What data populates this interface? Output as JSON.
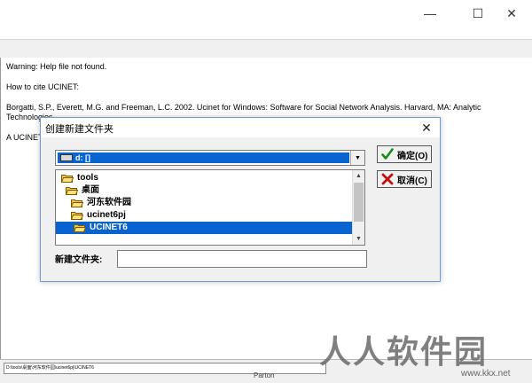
{
  "window": {
    "controls": {
      "minimize": "—",
      "maximize": "☐",
      "close": "✕"
    }
  },
  "main": {
    "lines": [
      "Warning: Help file not found.",
      "How to cite UCINET:",
      "Borgatti, S.P., Everett, M.G. and Freeman, L.C. 2002. Ucinet for Windows: Software for Social Network Analysis. Harvard, MA: Analytic",
      "Technologies.",
      "A UCINET"
    ]
  },
  "status": {
    "path": "D:\\tools\\桌面\\河东软件园\\ucinet6pj\\UCINET6",
    "text": "Parton"
  },
  "watermark": {
    "brand": "人人软件园",
    "url": "www.kkx.net"
  },
  "dialog": {
    "title": "创建新建文件夹",
    "close": "✕",
    "drive": "d: []",
    "drive_arrow": "▼",
    "folders": [
      "tools",
      "桌面",
      "河东软件园",
      "ucinet6pj",
      "UCINET6"
    ],
    "new_folder_label": "新建文件夹:",
    "new_folder_value": "",
    "ok_label": "确定(O)",
    "cancel_label": "取消(C)"
  },
  "colors": {
    "accent": "#0a64d0",
    "ok_icon": "#1a8a1a",
    "cancel_icon": "#c01010",
    "folder": "#f2c744"
  }
}
